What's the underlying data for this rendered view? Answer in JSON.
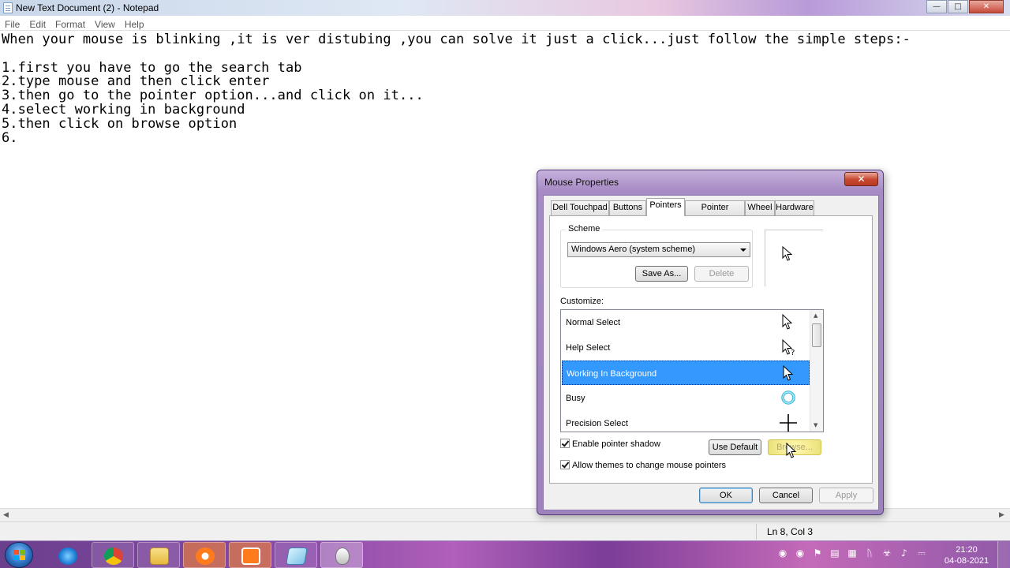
{
  "notepad": {
    "title": "New Text Document (2) - Notepad",
    "menu": [
      "File",
      "Edit",
      "Format",
      "View",
      "Help"
    ],
    "lines": [
      "When your mouse is blinking ,it is ver distubing ,you can solve it just a click...just follow the simple steps:-",
      "",
      "1.first you have to go the search tab",
      "2.type mouse and then click enter",
      "3.then go to the pointer option...and click on it...",
      "4.select working in background",
      "5.then click on browse option",
      "6."
    ],
    "status_position": "Ln 8, Col 3"
  },
  "dialog": {
    "title": "Mouse Properties",
    "tabs": [
      "Dell Touchpad",
      "Buttons",
      "Pointers",
      "Pointer Options",
      "Wheel",
      "Hardware"
    ],
    "active_tab": "Pointers",
    "scheme_label": "Scheme",
    "scheme_value": "Windows Aero (system scheme)",
    "save_as_label": "Save As...",
    "delete_label": "Delete",
    "customize_label": "Customize:",
    "list_items": [
      {
        "label": "Normal Select",
        "cursor": "arrow-cursor-icon"
      },
      {
        "label": "Help Select",
        "cursor": "help-cursor-icon"
      },
      {
        "label": "Working In Background",
        "cursor": "working-cursor-icon",
        "selected": true
      },
      {
        "label": "Busy",
        "cursor": "busy-ring-icon"
      },
      {
        "label": "Precision Select",
        "cursor": "crosshair-cursor-icon"
      }
    ],
    "enable_shadow_label": "Enable pointer shadow",
    "allow_themes_label": "Allow themes to change mouse pointers",
    "use_default_label": "Use Default",
    "browse_label": "Browse...",
    "ok_label": "OK",
    "cancel_label": "Cancel",
    "apply_label": "Apply"
  },
  "taskbar": {
    "time": "21:20",
    "date": "04-08-2021"
  },
  "colors": {
    "selection": "#3399ff",
    "taskbar": "#8a4aa8"
  }
}
